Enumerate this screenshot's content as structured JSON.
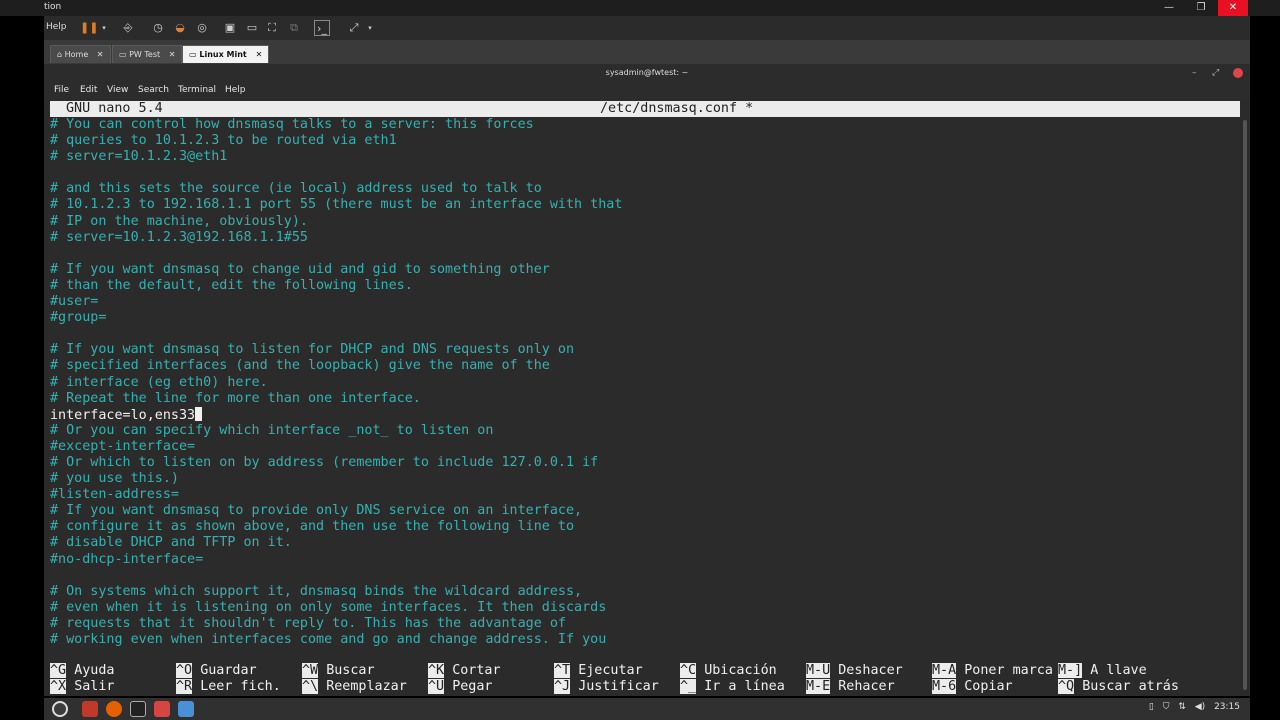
{
  "vm": {
    "title": "tion",
    "menu_help": "Help",
    "tabs": [
      {
        "label": "Home"
      },
      {
        "label": "PW Test"
      },
      {
        "label": "Linux Mint"
      }
    ],
    "close_glyph": "✕"
  },
  "terminal": {
    "title": "sysadmin@fwtest: ~",
    "menu": [
      "File",
      "Edit",
      "View",
      "Search",
      "Terminal",
      "Help"
    ]
  },
  "nano": {
    "version": "GNU nano 5.4",
    "filename": "/etc/dnsmasq.conf *",
    "lines": [
      "# You can control how dnsmasq talks to a server: this forces",
      "# queries to 10.1.2.3 to be routed via eth1",
      "# server=10.1.2.3@eth1",
      "",
      "# and this sets the source (ie local) address used to talk to",
      "# 10.1.2.3 to 192.168.1.1 port 55 (there must be an interface with that",
      "# IP on the machine, obviously).",
      "# server=10.1.2.3@192.168.1.1#55",
      "",
      "# If you want dnsmasq to change uid and gid to something other",
      "# than the default, edit the following lines.",
      "#user=",
      "#group=",
      "",
      "# If you want dnsmasq to listen for DHCP and DNS requests only on",
      "# specified interfaces (and the loopback) give the name of the",
      "# interface (eg eth0) here.",
      "# Repeat the line for more than one interface.",
      "interface=lo,ens33",
      "# Or you can specify which interface _not_ to listen on",
      "#except-interface=",
      "# Or which to listen on by address (remember to include 127.0.0.1 if",
      "# you use this.)",
      "#listen-address=",
      "# If you want dnsmasq to provide only DNS service on an interface,",
      "# configure it as shown above, and then use the following line to",
      "# disable DHCP and TFTP on it.",
      "#no-dhcp-interface=",
      "",
      "# On systems which support it, dnsmasq binds the wildcard address,",
      "# even when it is listening on only some interfaces. It then discards",
      "# requests that it shouldn't reply to. This has the advantage of",
      "# working even when interfaces come and go and change address. If you"
    ],
    "shortcuts_row1": [
      {
        "key": "^G",
        "label": "Ayuda"
      },
      {
        "key": "^O",
        "label": "Guardar"
      },
      {
        "key": "^W",
        "label": "Buscar"
      },
      {
        "key": "^K",
        "label": "Cortar"
      },
      {
        "key": "^T",
        "label": "Ejecutar"
      },
      {
        "key": "^C",
        "label": "Ubicación"
      },
      {
        "key": "M-U",
        "label": "Deshacer"
      },
      {
        "key": "M-A",
        "label": "Poner marca"
      },
      {
        "key": "M-]",
        "label": "A llave"
      }
    ],
    "shortcuts_row2": [
      {
        "key": "^X",
        "label": "Salir"
      },
      {
        "key": "^R",
        "label": "Leer fich."
      },
      {
        "key": "^\\",
        "label": "Reemplazar"
      },
      {
        "key": "^U",
        "label": "Pegar"
      },
      {
        "key": "^J",
        "label": "Justificar"
      },
      {
        "key": "^_",
        "label": "Ir a línea"
      },
      {
        "key": "M-E",
        "label": "Rehacer"
      },
      {
        "key": "M-6",
        "label": "Copiar"
      },
      {
        "key": "^Q",
        "label": "Buscar atrás"
      }
    ]
  },
  "taskbar": {
    "clock": "23:15"
  }
}
